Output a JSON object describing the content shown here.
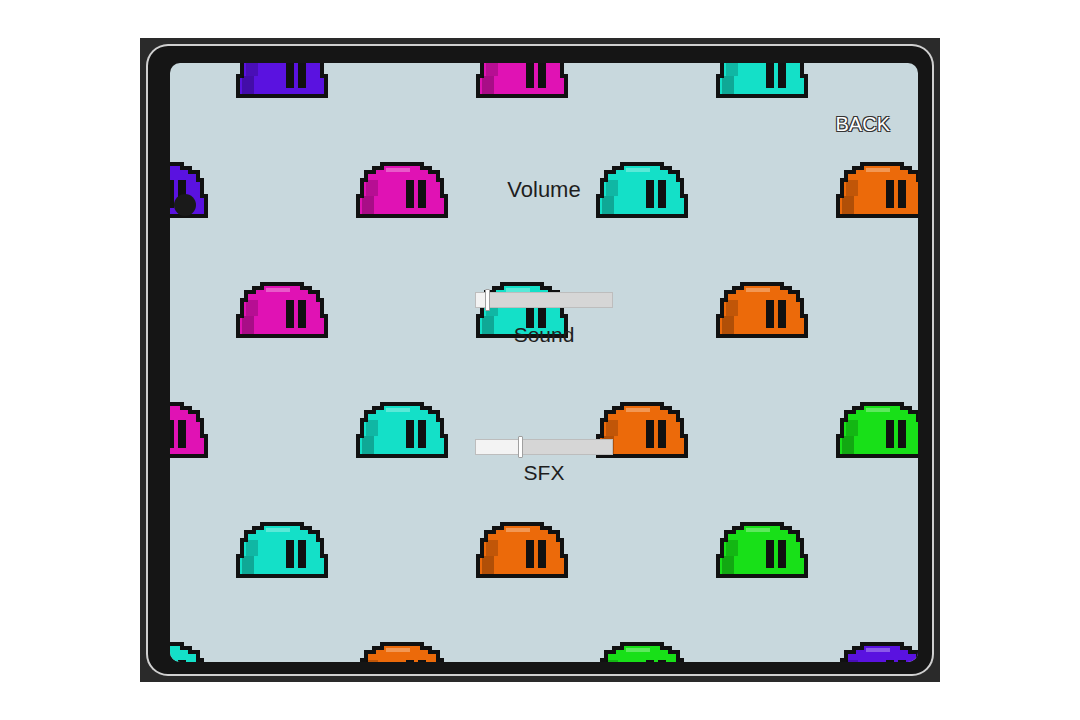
{
  "screen": {
    "title": "Volume",
    "back_button": "BACK"
  },
  "sliders": [
    {
      "label": "Sound",
      "level": 0.08
    },
    {
      "label": "SFX",
      "level": 0.32
    }
  ]
}
